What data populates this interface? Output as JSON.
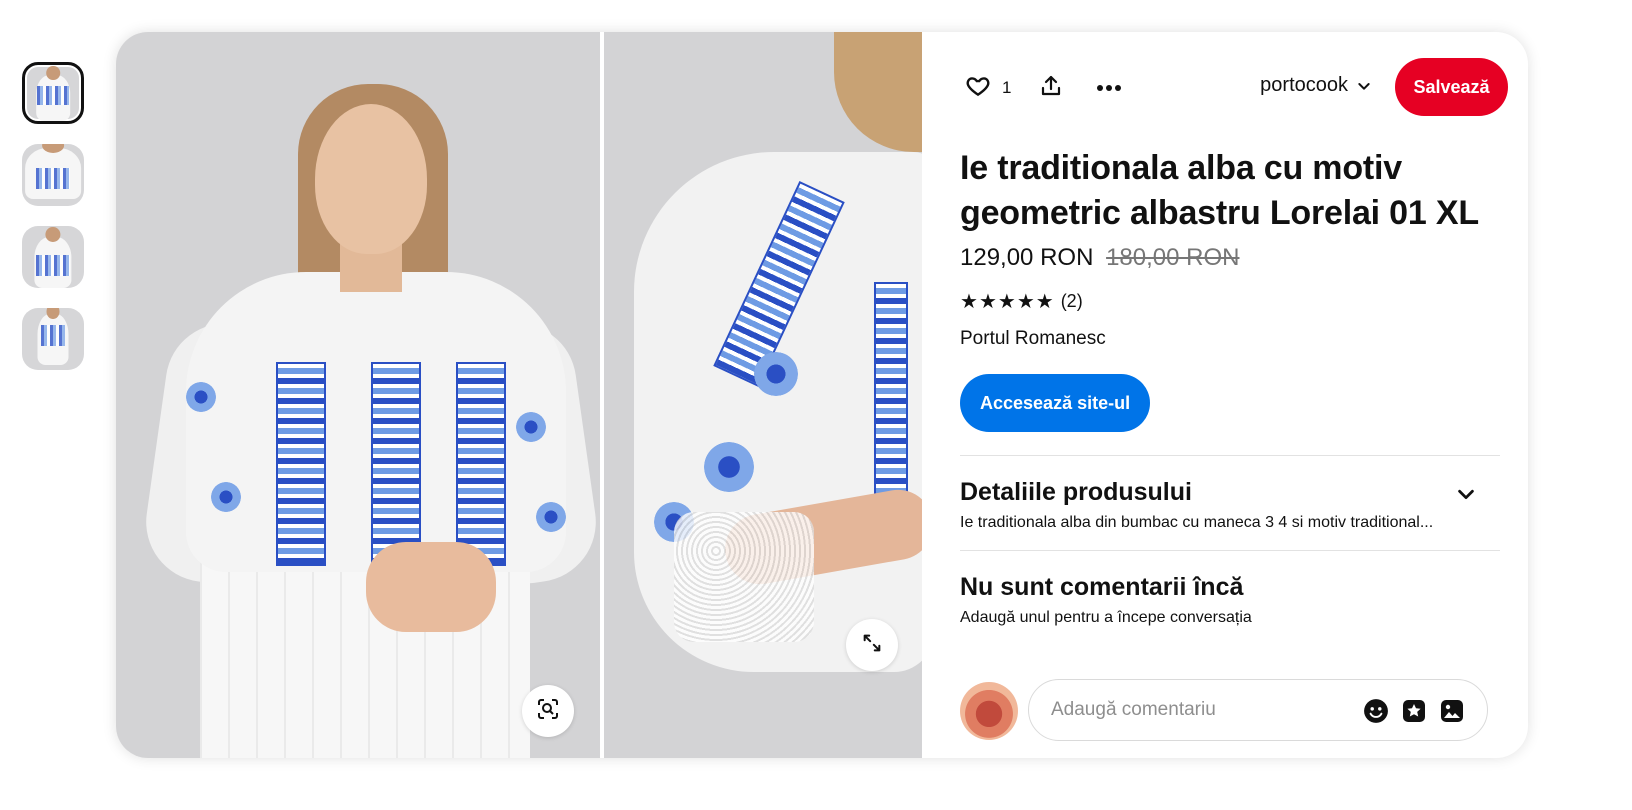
{
  "thumbnails": [
    {
      "label": "thumb-1",
      "active": true
    },
    {
      "label": "thumb-2",
      "active": false
    },
    {
      "label": "thumb-3",
      "active": false
    },
    {
      "label": "thumb-4",
      "active": false
    }
  ],
  "topbar": {
    "like_count": "1",
    "username": "portocook",
    "save_label": "Salvează"
  },
  "product": {
    "title": "Ie traditionala alba cu motiv geometric albastru Lorelai 01 XL",
    "price": "129,00 RON",
    "old_price": "180,00 RON",
    "rating_stars": 5,
    "rating_count": "(2)",
    "merchant": "Portul Romanesc",
    "visit_label": "Accesează site-ul"
  },
  "details": {
    "heading": "Detaliile produsului",
    "text": "Ie traditionala alba din bumbac cu maneca 3 4 si motiv traditional..."
  },
  "comments": {
    "heading": "Nu sunt comentarii încă",
    "subtext": "Adaugă unul pentru a începe conversația",
    "placeholder": "Adaugă comentariu"
  },
  "colors": {
    "save": "#e60023",
    "visit": "#0074e8"
  },
  "icons": {
    "like": "heart-icon",
    "share": "share-icon",
    "more": "more-icon",
    "user_dropdown": "chevron-down-icon",
    "visual_search": "visual-search-icon",
    "expand": "expand-icon",
    "details_toggle": "chevron-down-icon",
    "emoji": "emoji-icon",
    "sticker": "sticker-icon",
    "image": "image-icon"
  }
}
